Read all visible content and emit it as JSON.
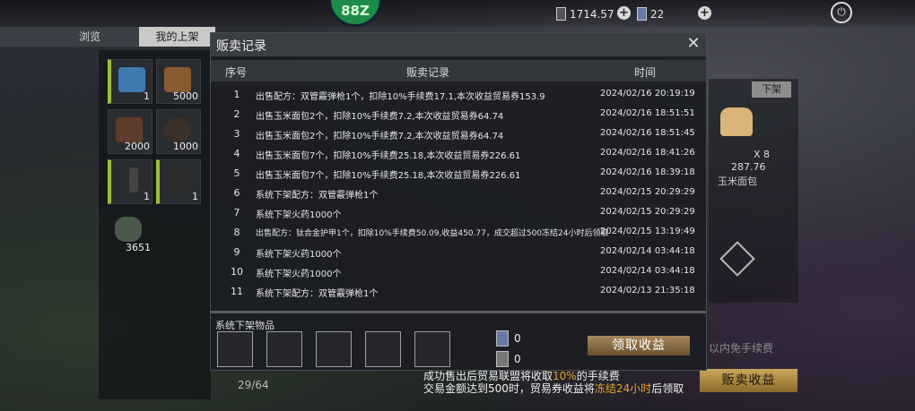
{
  "topbar": {
    "badge_text": "88Z",
    "currency1": "1714.57",
    "currency2": "22"
  },
  "tabs": [
    "浏览",
    "我的上架"
  ],
  "inventory": {
    "slots": [
      {
        "qty": "1"
      },
      {
        "qty": "5000"
      },
      {
        "qty": "2000"
      },
      {
        "qty": "1000"
      },
      {
        "qty": "1"
      },
      {
        "qty": "1"
      },
      {
        "qty": "3651"
      }
    ],
    "count": "29/64"
  },
  "right_panel": {
    "unlist_label": "下架",
    "item_qty": "X 8",
    "item_price": "287.76",
    "item_name": "玉米面包"
  },
  "background": {
    "tip": "以内免手续费",
    "notice_line1_pre": "成功售出后贸易联盟将收取",
    "notice_line1_hl": "10%",
    "notice_line1_post": "的手续费",
    "notice_line2_pre": "交易金额达到500时，贸易券收益将",
    "notice_line2_hl": "冻结24小时",
    "notice_line2_post": "后领取",
    "sell_income_label": "贩卖收益"
  },
  "modal": {
    "title": "贩卖记录",
    "close": "✕",
    "headers": {
      "idx": "序号",
      "record": "贩卖记录",
      "time": "时间"
    },
    "rows": [
      {
        "idx": "1",
        "desc": "出售配方：双管霰弹枪1个，扣除10%手续费17.1,本次收益贸易券153.9",
        "time": "2024/02/16 20:19:19"
      },
      {
        "idx": "2",
        "desc": "出售玉米面包2个，扣除10%手续费7.2,本次收益贸易券64.74",
        "time": "2024/02/16 18:51:51"
      },
      {
        "idx": "3",
        "desc": "出售玉米面包2个，扣除10%手续费7.2,本次收益贸易券64.74",
        "time": "2024/02/16 18:51:45"
      },
      {
        "idx": "4",
        "desc": "出售玉米面包7个，扣除10%手续费25.18,本次收益贸易券226.61",
        "time": "2024/02/16 18:41:26"
      },
      {
        "idx": "5",
        "desc": "出售玉米面包7个，扣除10%手续费25.18,本次收益贸易券226.61",
        "time": "2024/02/16 18:39:18"
      },
      {
        "idx": "6",
        "desc": "系统下架配方：双管霰弹枪1个",
        "time": "2024/02/15 20:29:29"
      },
      {
        "idx": "7",
        "desc": "系统下架火药1000个",
        "time": "2024/02/15 20:29:29"
      },
      {
        "idx": "8",
        "desc": "出售配方：钛合金护甲1个，扣除10%手续费50.09,收益450.77，成交超过500冻结24小时后领取",
        "time": "2024/02/15 13:19:49"
      },
      {
        "idx": "9",
        "desc": "系统下架火药1000个",
        "time": "2024/02/14 03:44:18"
      },
      {
        "idx": "10",
        "desc": "系统下架火药1000个",
        "time": "2024/02/14 03:44:18"
      },
      {
        "idx": "11",
        "desc": "系统下架配方：双管霰弹枪1个",
        "time": "2024/02/13 21:35:18"
      }
    ],
    "system_items_label": "系统下架物品",
    "ticket1_value": "0",
    "ticket2_value": "0",
    "claim_label": "领取收益"
  }
}
